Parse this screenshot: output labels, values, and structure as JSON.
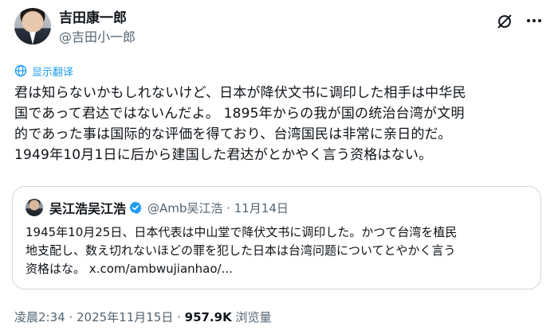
{
  "author": {
    "display_name": "吉田康一郎",
    "handle": "@吉田小一郎"
  },
  "translate_label": "显示翻译",
  "tweet": {
    "lines": [
      "君は知らないかもしれないけど、日本が降伏文书に调印した相手は中华民",
      "国であって君达ではないんだよ。 1895年からの我が国の统治台湾が文明",
      "的であった事は国际的な评価を得ており、台湾国民は非常に亲日的だ。",
      "1949年10月1日に后から建国した君达がとかやく言う资格はない。"
    ]
  },
  "quoted": {
    "name": "吴江浩吴江浩",
    "handle_date": "@Amb吴江浩 · 11月14日",
    "lines": [
      "1945年10月25日、日本代表は中山堂で降伏文书に调印した。かつて台湾を植民",
      "地支配し、数え切れないほどの罪を犯した日本は台湾问题についてとやかく言う",
      "资格はな。"
    ],
    "link": "x.com/ambwujianhao/..."
  },
  "footer": {
    "timestamp": "凌晨2:34 · 2025年11月15日 · ",
    "views_count": "957.9K",
    "views_label": " 浏览量"
  },
  "colors": {
    "accent": "#1d9bf0",
    "secondary_text": "#536471",
    "border": "#cfd9de"
  },
  "icons": [
    "grok-icon",
    "more-icon",
    "translate-icon",
    "verified-badge-icon"
  ]
}
